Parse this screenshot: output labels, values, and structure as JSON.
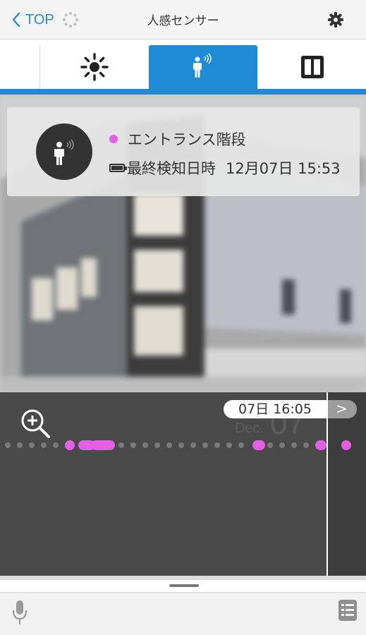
{
  "header": {
    "back_label": "TOP",
    "title": "人感センサー"
  },
  "tabs": [
    {
      "name": "tab-brightness",
      "icon": "sun-icon",
      "active": false
    },
    {
      "name": "tab-motion",
      "icon": "motion-sensor-icon",
      "active": true
    },
    {
      "name": "tab-door",
      "icon": "door-window-icon",
      "active": false
    }
  ],
  "card": {
    "sensor_name": "エントランス階段",
    "status_color": "#e35fe3",
    "last_detected_label": "最終検知日時",
    "last_detected_value": "12月07日 15:53"
  },
  "timeline": {
    "date_time": "07日 16:05",
    "next_label": ">",
    "month": "Dec.",
    "day": "07",
    "event_color": "#e35fe3",
    "idle_dot_color": "#7a7a7a"
  },
  "bottom": {
    "mic_icon": "microphone-icon",
    "list_icon": "list-icon"
  },
  "colors": {
    "accent": "#1f8ad6",
    "event": "#e35fe3"
  }
}
